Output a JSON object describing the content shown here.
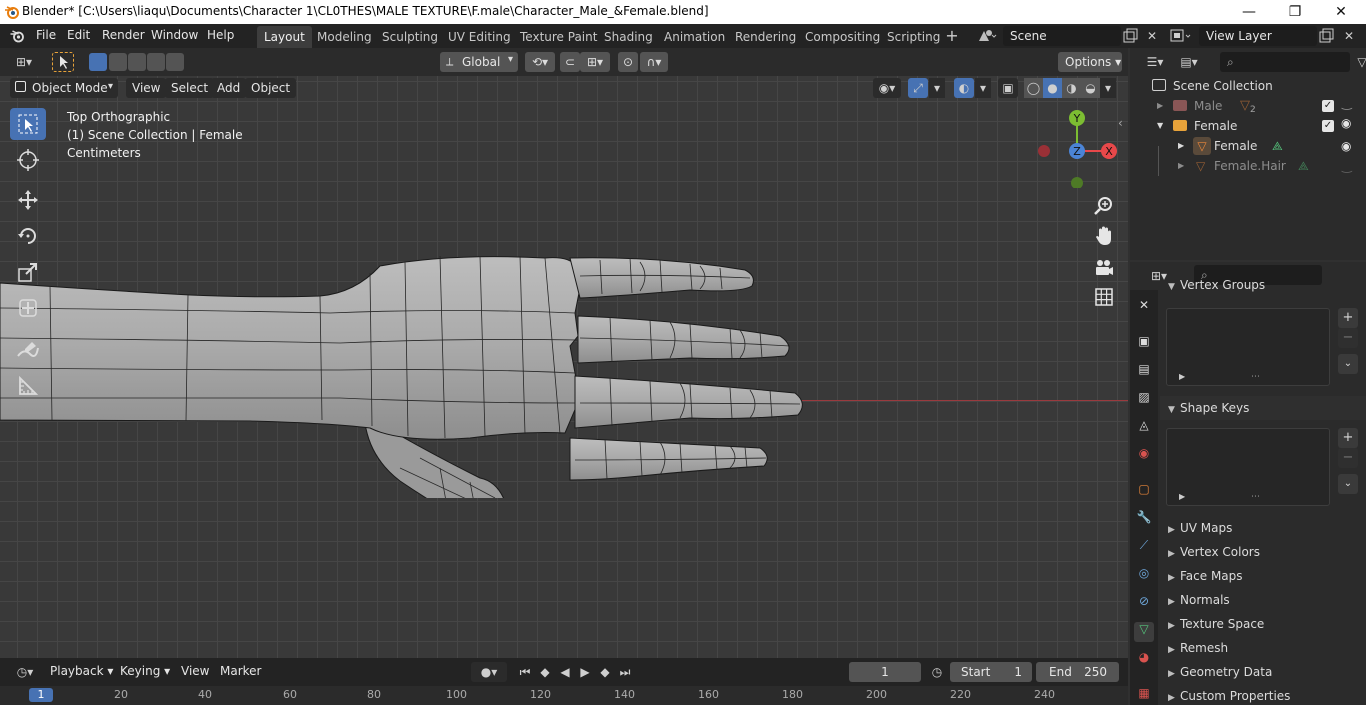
{
  "window": {
    "title": "Blender* [C:\\Users\\liaqu\\Documents\\Character 1\\CL0THES\\MALE TEXTURE\\F.male\\Character_Male_&Female.blend]",
    "minimize": "—",
    "maximize": "❐",
    "close": "✕"
  },
  "menu": {
    "file": "File",
    "edit": "Edit",
    "render": "Render",
    "window": "Window",
    "help": "Help"
  },
  "workspaces": [
    "Layout",
    "Modeling",
    "Sculpting",
    "UV Editing",
    "Texture Paint",
    "Shading",
    "Animation",
    "Rendering",
    "Compositing",
    "Scripting"
  ],
  "scene": {
    "name": "Scene",
    "view_layer": "View Layer"
  },
  "tool_header": {
    "orientation": "Global",
    "options": "Options"
  },
  "viewport_header": {
    "mode": "Object Mode",
    "view": "View",
    "select": "Select",
    "add": "Add",
    "object": "Object"
  },
  "viewport_overlay": {
    "view_name": "Top Orthographic",
    "collection_info": "(1) Scene Collection | Female",
    "units": "Centimeters"
  },
  "gizmo": {
    "x": "X",
    "y": "Y",
    "z": "Z"
  },
  "outliner": {
    "root": "Scene Collection",
    "items": [
      {
        "name": "Male",
        "badge": "2"
      },
      {
        "name": "Female"
      },
      {
        "name": "Female"
      },
      {
        "name": "Female.Hair"
      }
    ]
  },
  "properties": {
    "sections": {
      "vertex_groups": "Vertex Groups",
      "shape_keys": "Shape Keys",
      "uv_maps": "UV Maps",
      "vertex_colors": "Vertex Colors",
      "face_maps": "Face Maps",
      "normals": "Normals",
      "texture_space": "Texture Space",
      "remesh": "Remesh",
      "geometry_data": "Geometry Data",
      "custom_properties": "Custom Properties"
    },
    "add": "+",
    "remove": "−"
  },
  "timeline": {
    "playback": "Playback",
    "keying": "Keying",
    "view": "View",
    "marker": "Marker",
    "current_frame": "1",
    "start_label": "Start",
    "start_value": "1",
    "end_label": "End",
    "end_value": "250",
    "ruler": [
      "1",
      "20",
      "40",
      "60",
      "80",
      "100",
      "120",
      "140",
      "160",
      "180",
      "200",
      "220",
      "240"
    ]
  },
  "colors": {
    "accent": "#4772b3",
    "x_axis": "#e8484a",
    "y_axis": "#7cbd32",
    "z_axis": "#4b84d6",
    "object_orange": "#e8863a",
    "mesh_green": "#55c37b"
  }
}
